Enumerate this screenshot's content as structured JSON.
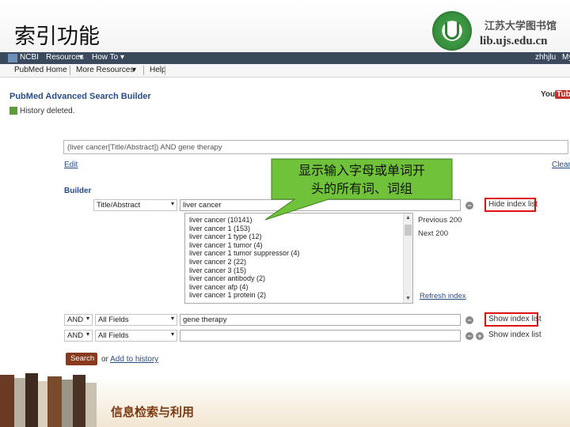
{
  "slide": {
    "title": "索引功能",
    "library_name": "江苏大学图书馆",
    "library_url": "lib.ujs.edu.cn",
    "footer": "信息检索与利用"
  },
  "ncbi_bar": {
    "logo": "NCBI",
    "resources": "Resources",
    "how_to": "How To",
    "user": "zhhjlu",
    "my": "My"
  },
  "nav": {
    "items": [
      "PubMed Home",
      "More Resources",
      "Help"
    ]
  },
  "page": {
    "heading": "PubMed Advanced Search Builder",
    "youtube": {
      "prefix": "You",
      "suffix": "Tube"
    },
    "status": "History deleted."
  },
  "query": {
    "text": "(liver cancer[Title/Abstract]) AND gene therapy",
    "edit_label": "Edit",
    "clear_label": "Clear"
  },
  "builder": {
    "label": "Builder",
    "rows": [
      {
        "operator": "",
        "field": "Title/Abstract",
        "term": "liver cancer",
        "index_link": "Hide index list"
      },
      {
        "operator": "AND",
        "field": "All Fields",
        "term": "gene therapy",
        "index_link": "Show index list"
      },
      {
        "operator": "AND",
        "field": "All Fields",
        "term": "",
        "index_link": "Show index list"
      }
    ],
    "index_list": [
      "liver cancer (10141)",
      "liver cancer 1 (153)",
      "liver cancer 1 type (12)",
      "liver cancer 1 tumor (4)",
      "liver cancer 1 tumor suppressor (4)",
      "liver cancer 2 (22)",
      "liver cancer 3 (15)",
      "liver cancer antibody (2)",
      "liver cancer afp (4)",
      "liver cancer 1 protein (2)"
    ],
    "previous_label": "Previous 200",
    "next_label": "Next 200",
    "refresh_label": "Refresh index",
    "search_button": "Search",
    "or_text": "or",
    "add_history_link": "Add to history"
  },
  "callout": {
    "line1": "显示输入字母或单词开",
    "line2": "头的所有词、词组"
  },
  "colors": {
    "ncbi_bar": "#3a4a5c",
    "callout_fill": "#6fc23a",
    "link": "#2a4d86",
    "highlight": "#dd1111",
    "search_button": "#8a3a1c"
  }
}
